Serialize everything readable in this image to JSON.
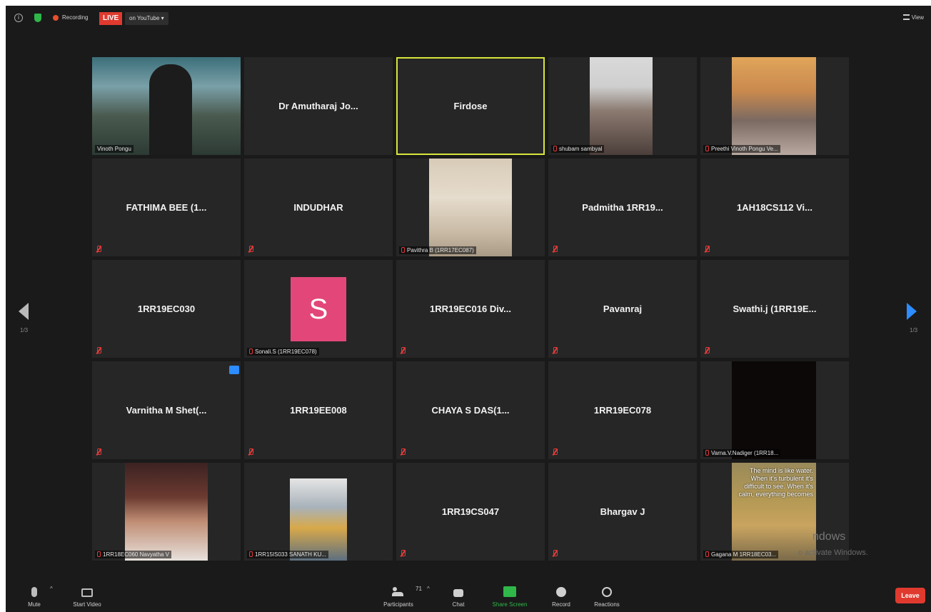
{
  "topbar": {
    "info": "i",
    "recording_label": "Recording",
    "live_badge": "LIVE",
    "stream_target": "on YouTube ▾",
    "view_label": "View"
  },
  "gallery": {
    "page_left": "1/3",
    "page_right": "1/3",
    "tiles": [
      {
        "name": "",
        "label": "Vinoth Pongu",
        "type": "video"
      },
      {
        "name": "Dr Amutharaj Jo...",
        "type": "name"
      },
      {
        "name": "Firdose",
        "type": "name",
        "active": true
      },
      {
        "name": "",
        "label": "shubam sambyal",
        "type": "video"
      },
      {
        "name": "",
        "label": "Preethi Vinoth Pongu Ve...",
        "type": "video"
      },
      {
        "name": "FATHIMA BEE (1...",
        "type": "name"
      },
      {
        "name": "INDUDHAR",
        "type": "name"
      },
      {
        "name": "",
        "label": "Pavithra B (1RR17EC087)",
        "type": "video"
      },
      {
        "name": "Padmitha 1RR19...",
        "type": "name"
      },
      {
        "name": "1AH18CS112 Vi...",
        "type": "name"
      },
      {
        "name": "1RR19EC030",
        "type": "name"
      },
      {
        "name": "",
        "label": "Sonali.S (1RR19EC078)",
        "avatar": "S",
        "type": "avatar"
      },
      {
        "name": "1RR19EC016 Div...",
        "type": "name"
      },
      {
        "name": "Pavanraj",
        "type": "name"
      },
      {
        "name": "Swathi.j (1RR19E...",
        "type": "name"
      },
      {
        "name": "Varnitha M Shet(...",
        "type": "name"
      },
      {
        "name": "1RR19EE008",
        "type": "name"
      },
      {
        "name": "CHAYA S DAS(1...",
        "type": "name"
      },
      {
        "name": "1RR19EC078",
        "type": "name"
      },
      {
        "name": "",
        "label": "Varna.V.Nadiger (1RR18...",
        "type": "video"
      },
      {
        "name": "",
        "label": "1RR18EC060 Navyatha V",
        "type": "video"
      },
      {
        "name": "",
        "label": "1RR15IS033 SANATH KU...",
        "type": "video"
      },
      {
        "name": "1RR19CS047",
        "type": "name"
      },
      {
        "name": "Bhargav J",
        "type": "name"
      },
      {
        "name": "",
        "label": "Gagana M 1RR18EC03...",
        "type": "video"
      }
    ],
    "quote_text": "The mind is like water. When it's turbulent it's difficult to see. When it's calm, everything becomes"
  },
  "watermark": {
    "line1": "ndows",
    "line2": "o activate Windows."
  },
  "toolbar": {
    "mute": "Mute",
    "start_video": "Start Video",
    "participants": "Participants",
    "participants_count": "71",
    "chat": "Chat",
    "share_screen": "Share Screen",
    "record": "Record",
    "reactions": "Reactions",
    "leave": "Leave"
  }
}
